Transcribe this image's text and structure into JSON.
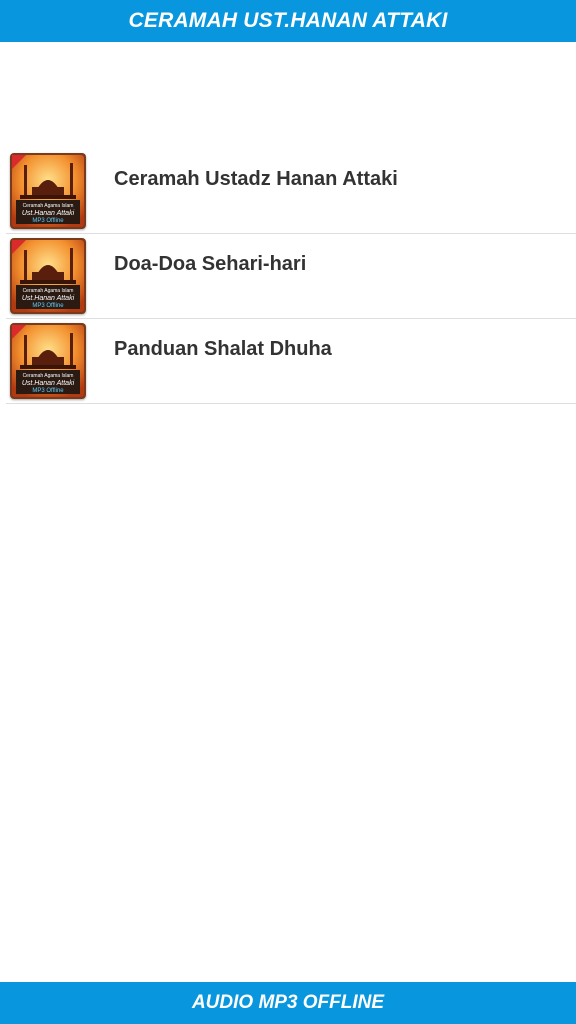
{
  "header": {
    "title": "CERAMAH UST.HANAN ATTAKI",
    "background_color": "#0897de"
  },
  "list": {
    "items": [
      {
        "label": "Ceramah Ustadz Hanan Attaki",
        "icon": "mosque-app-thumbnail-icon"
      },
      {
        "label": "Doa-Doa Sehari-hari",
        "icon": "mosque-app-thumbnail-icon"
      },
      {
        "label": "Panduan Shalat Dhuha",
        "icon": "mosque-app-thumbnail-icon"
      }
    ],
    "thumbnail_text": {
      "line1": "Ceramah Agama Islam",
      "line2": "Ust.Hanan Attaki",
      "line3": "MP3 Offline"
    }
  },
  "footer": {
    "text": "AUDIO MP3 OFFLINE",
    "background_color": "#0897de"
  }
}
